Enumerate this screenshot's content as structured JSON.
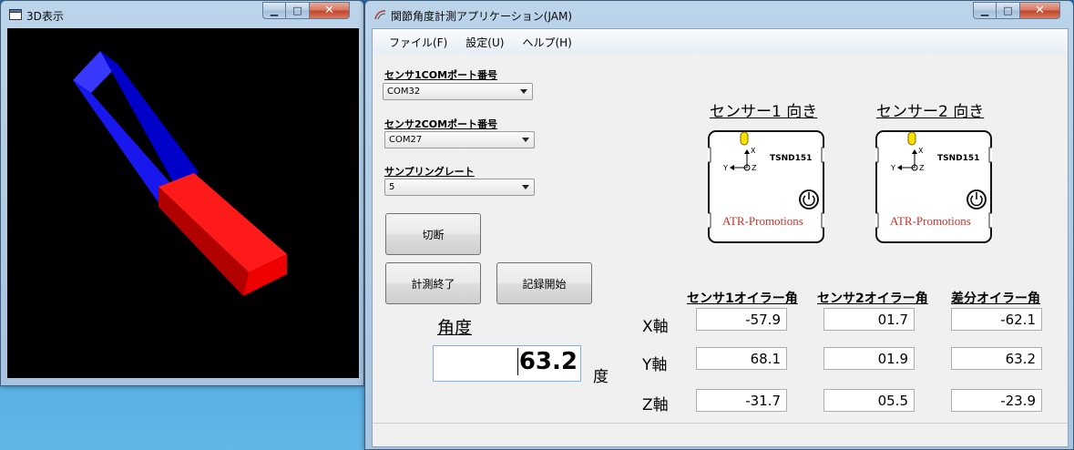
{
  "window_3d": {
    "title": "3D表示",
    "min_glyph": "▁",
    "max_glyph": "□",
    "close_glyph": "✕"
  },
  "window_main": {
    "title": "関節角度計測アプリケーション(JAM)",
    "min_glyph": "▁",
    "max_glyph": "□",
    "close_glyph": "✕"
  },
  "menu": [
    "ファイル(F)",
    "設定(U)",
    "ヘルプ(H)"
  ],
  "settings": {
    "sensor1_port_label": "センサ1COMポート番号",
    "sensor1_port_value": "COM32",
    "sensor2_port_label": "センサ2COMポート番号",
    "sensor2_port_value": "COM27",
    "sampling_rate_label": "サンプリングレート",
    "sampling_rate_value": "5"
  },
  "buttons": {
    "disconnect": "切断",
    "stop_measure": "計測終了",
    "start_record": "記録開始"
  },
  "angle": {
    "label": "角度",
    "value": "63.2",
    "unit": "度"
  },
  "sensors": {
    "sensor1_heading": "センサー1 向き",
    "sensor2_heading": "センサー2 向き",
    "model": "TSND151",
    "brand": "ATR-Promotions",
    "axis_x": "X",
    "axis_y": "Y",
    "axis_z": "Z"
  },
  "euler_table": {
    "columns": [
      "センサ1オイラー角",
      "センサ2オイラー角",
      "差分オイラー角"
    ],
    "rows": [
      {
        "axis": "X軸",
        "values": [
          "-57.9",
          "01.7",
          "-62.1"
        ]
      },
      {
        "axis": "Y軸",
        "values": [
          "68.1",
          "01.9",
          "63.2"
        ]
      },
      {
        "axis": "Z軸",
        "values": [
          "-31.7",
          "05.5",
          "-23.9"
        ]
      }
    ]
  },
  "colors": {
    "sensor1_bar": "#1a1aff",
    "sensor2_bar": "#ff1111",
    "brand_red": "#c8322a",
    "led_yellow": "#ffe000"
  }
}
